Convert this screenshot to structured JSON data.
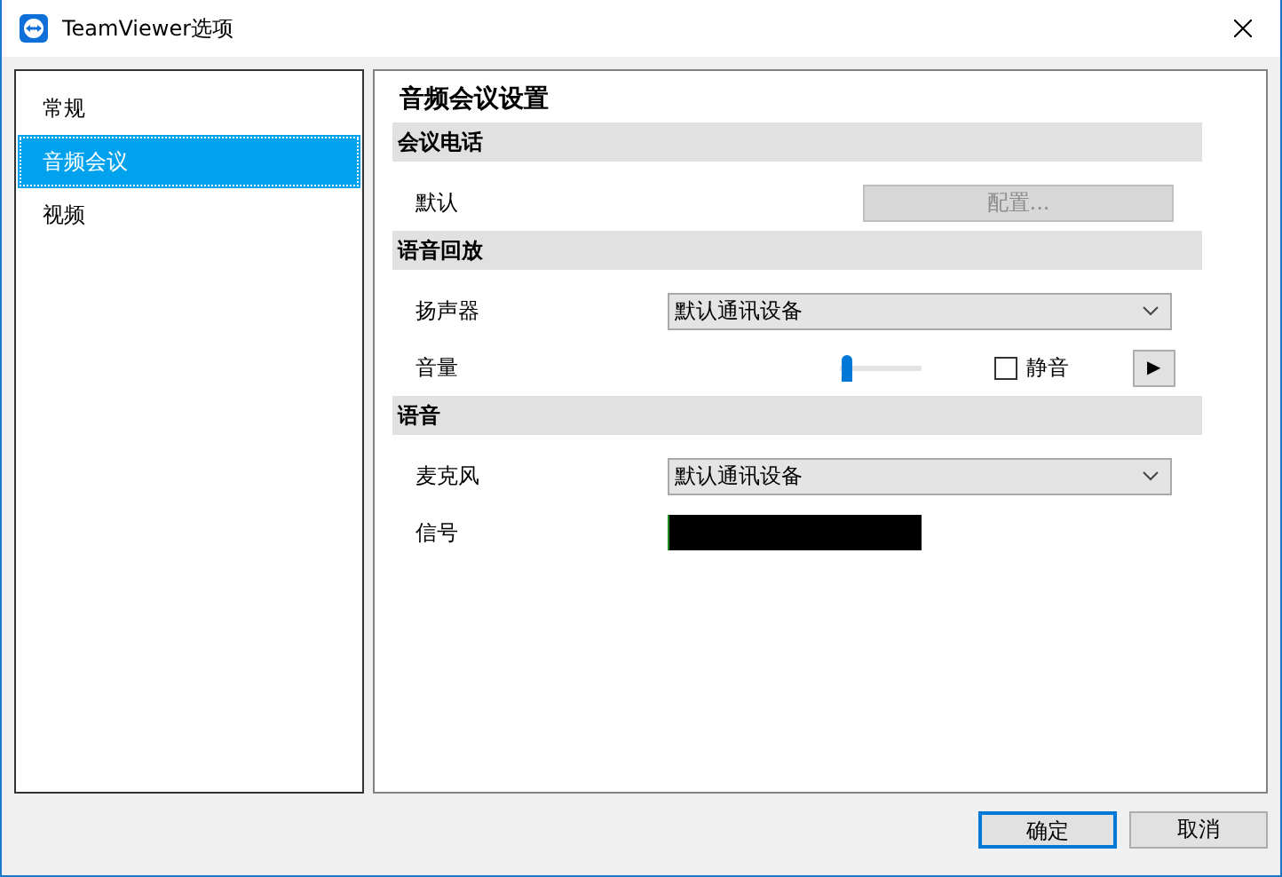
{
  "window": {
    "title": "TeamViewer选项"
  },
  "sidebar": {
    "items": [
      {
        "label": "常规",
        "selected": false
      },
      {
        "label": "音频会议",
        "selected": true
      },
      {
        "label": "视频",
        "selected": false
      }
    ]
  },
  "panel": {
    "title": "音频会议设置",
    "sections": [
      {
        "heading": "会议电话",
        "rows": [
          {
            "kind": "button",
            "label": "默认",
            "button": "配置...",
            "disabled": true
          }
        ]
      },
      {
        "heading": "语音回放",
        "rows": [
          {
            "kind": "select",
            "label": "扬声器",
            "value": "默认通讯设备"
          },
          {
            "kind": "volume",
            "label": "音量",
            "level": 0.02,
            "mute_label": "静音",
            "checked": false,
            "play": "▶"
          }
        ]
      },
      {
        "heading": "语音",
        "rows": [
          {
            "kind": "select",
            "label": "麦克风",
            "value": "默认通讯设备"
          },
          {
            "kind": "meter",
            "label": "信号",
            "level": 0.01
          }
        ]
      }
    ]
  },
  "buttons": [
    {
      "label": "确定",
      "selected": true
    },
    {
      "label": "取消",
      "selected": false
    }
  ]
}
